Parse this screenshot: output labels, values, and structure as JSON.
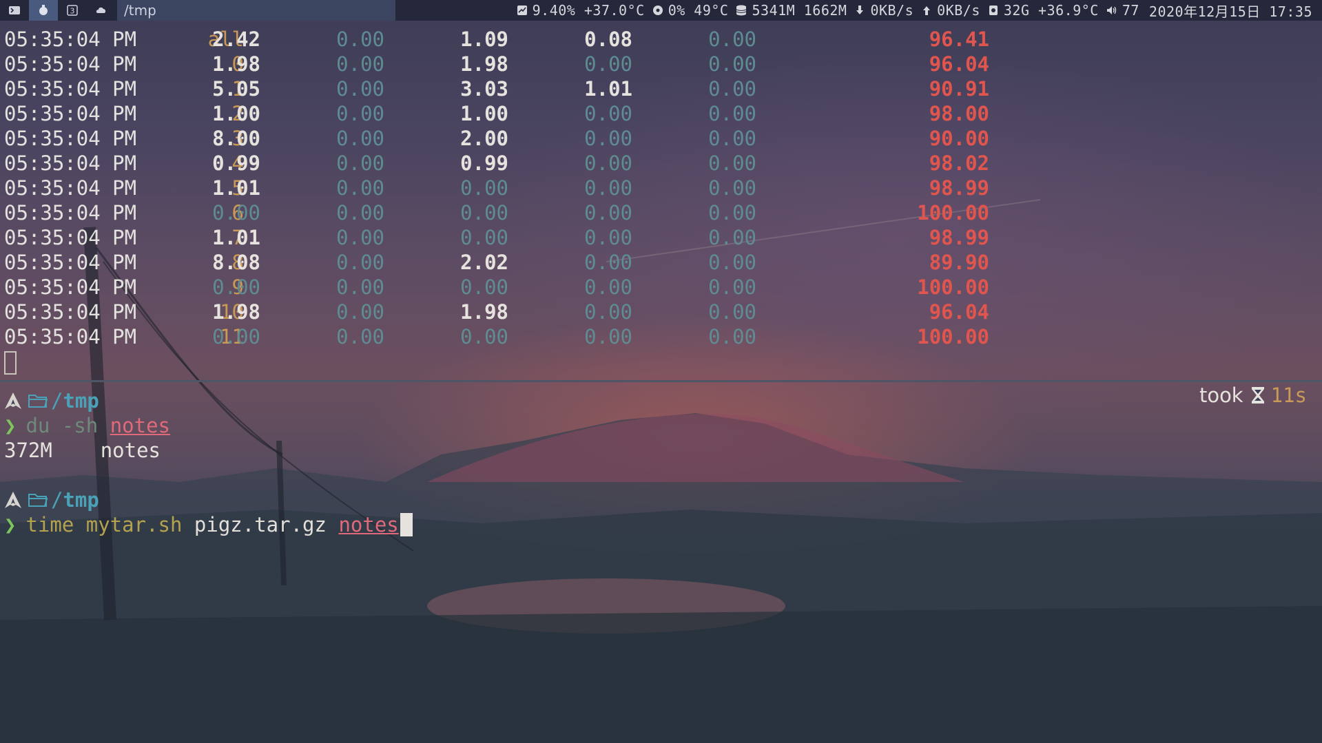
{
  "topbar": {
    "window_title": "/tmp",
    "workspaces": [
      "terminal-icon",
      "app-icon",
      "number-3-icon",
      "cloud-icon"
    ],
    "status": {
      "cpu": "9.40% +37.0°C",
      "gpu": "0% 49°C",
      "memory": "5341M 1662M",
      "download": "0KB/s",
      "upload": "0KB/s",
      "disk": "32G +36.9°C",
      "volume": "77",
      "datetime": "2020年12月15日 17:35"
    }
  },
  "mpstat": {
    "rows": [
      {
        "time": "05:35:04 PM",
        "cpu": "all",
        "v1": "2.42",
        "v2": "0.00",
        "v3": "1.09",
        "v4": "0.08",
        "v5": "0.00",
        "idle": "96.41"
      },
      {
        "time": "05:35:04 PM",
        "cpu": "0",
        "v1": "1.98",
        "v2": "0.00",
        "v3": "1.98",
        "v4": "0.00",
        "v5": "0.00",
        "idle": "96.04"
      },
      {
        "time": "05:35:04 PM",
        "cpu": "1",
        "v1": "5.05",
        "v2": "0.00",
        "v3": "3.03",
        "v4": "1.01",
        "v5": "0.00",
        "idle": "90.91"
      },
      {
        "time": "05:35:04 PM",
        "cpu": "2",
        "v1": "1.00",
        "v2": "0.00",
        "v3": "1.00",
        "v4": "0.00",
        "v5": "0.00",
        "idle": "98.00"
      },
      {
        "time": "05:35:04 PM",
        "cpu": "3",
        "v1": "8.00",
        "v2": "0.00",
        "v3": "2.00",
        "v4": "0.00",
        "v5": "0.00",
        "idle": "90.00"
      },
      {
        "time": "05:35:04 PM",
        "cpu": "4",
        "v1": "0.99",
        "v2": "0.00",
        "v3": "0.99",
        "v4": "0.00",
        "v5": "0.00",
        "idle": "98.02"
      },
      {
        "time": "05:35:04 PM",
        "cpu": "5",
        "v1": "1.01",
        "v2": "0.00",
        "v3": "0.00",
        "v4": "0.00",
        "v5": "0.00",
        "idle": "98.99"
      },
      {
        "time": "05:35:04 PM",
        "cpu": "6",
        "v1": "0.00",
        "v2": "0.00",
        "v3": "0.00",
        "v4": "0.00",
        "v5": "0.00",
        "idle": "100.00"
      },
      {
        "time": "05:35:04 PM",
        "cpu": "7",
        "v1": "1.01",
        "v2": "0.00",
        "v3": "0.00",
        "v4": "0.00",
        "v5": "0.00",
        "idle": "98.99"
      },
      {
        "time": "05:35:04 PM",
        "cpu": "8",
        "v1": "8.08",
        "v2": "0.00",
        "v3": "2.02",
        "v4": "0.00",
        "v5": "0.00",
        "idle": "89.90"
      },
      {
        "time": "05:35:04 PM",
        "cpu": "9",
        "v1": "0.00",
        "v2": "0.00",
        "v3": "0.00",
        "v4": "0.00",
        "v5": "0.00",
        "idle": "100.00"
      },
      {
        "time": "05:35:04 PM",
        "cpu": "10",
        "v1": "1.98",
        "v2": "0.00",
        "v3": "1.98",
        "v4": "0.00",
        "v5": "0.00",
        "idle": "96.04"
      },
      {
        "time": "05:35:04 PM",
        "cpu": "11",
        "v1": "0.00",
        "v2": "0.00",
        "v3": "0.00",
        "v4": "0.00",
        "v5": "0.00",
        "idle": "100.00"
      }
    ]
  },
  "shell": {
    "path": "tmp",
    "took_label": "took",
    "took_value": "11s",
    "cmd1": {
      "command": "du -sh",
      "arg": "notes"
    },
    "output1": {
      "size": "372M",
      "name": "notes"
    },
    "cmd2": {
      "command": "time mytar.sh",
      "arg1": "pigz.tar.gz",
      "arg2": "notes"
    }
  },
  "colors": {
    "accent_path": "#4aa2b8",
    "prompt_chevron": "#7dc75a",
    "idle_red": "#e0564f",
    "cpu_label": "#c99a57"
  }
}
